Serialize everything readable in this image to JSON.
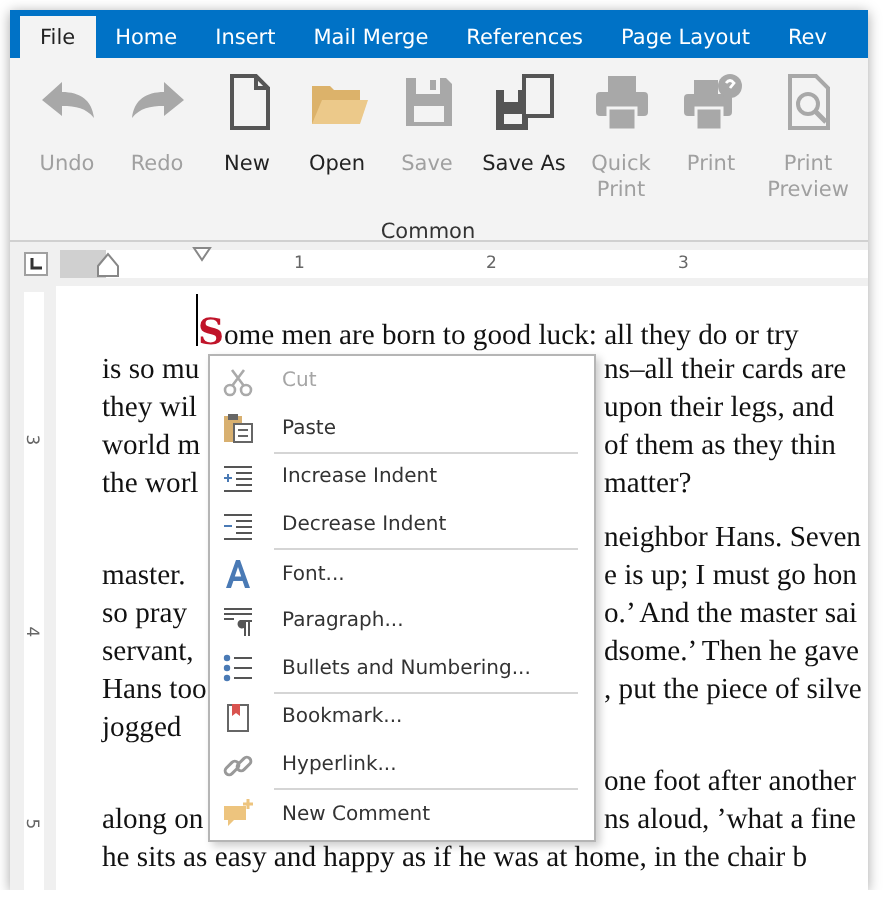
{
  "tabs": [
    {
      "label": "File",
      "selected": true
    },
    {
      "label": "Home",
      "selected": false
    },
    {
      "label": "Insert",
      "selected": false
    },
    {
      "label": "Mail Merge",
      "selected": false
    },
    {
      "label": "References",
      "selected": false
    },
    {
      "label": "Page Layout",
      "selected": false
    },
    {
      "label": "Rev",
      "selected": false
    }
  ],
  "ribbon": {
    "buttons": [
      {
        "label": "Undo",
        "disabled": true
      },
      {
        "label": "Redo",
        "disabled": true
      },
      {
        "label": "New",
        "disabled": false
      },
      {
        "label": "Open",
        "disabled": false
      },
      {
        "label": "Save",
        "disabled": true
      },
      {
        "label": "Save As",
        "disabled": false
      },
      {
        "label": "Quick Print",
        "disabled": true
      },
      {
        "label": "Print",
        "disabled": true
      },
      {
        "label": "Print Preview",
        "disabled": true
      }
    ],
    "group_label": "Common"
  },
  "ruler": {
    "numbers": [
      "1",
      "2",
      "3"
    ]
  },
  "vertical_ruler": {
    "numbers": [
      "3",
      "4",
      "5"
    ]
  },
  "document": {
    "paragraphs": [
      {
        "drop_cap": "S",
        "lines": [
          {
            "left": "ome men are born to good luck: all they do or try"
          },
          {
            "left": "is so mu",
            "right": "ns–all their cards are"
          },
          {
            "left": "they wil",
            "right": "upon their legs, and"
          },
          {
            "left": "world m",
            "right": "of them as they thin"
          },
          {
            "left": "the worl",
            "right": "matter?"
          }
        ]
      },
      {
        "lines": [
          {
            "right": "neighbor Hans. Seven"
          },
          {
            "left": "master.",
            "right": "e is up; I must go hon"
          },
          {
            "left": "so pray",
            "right": "o.’ And the master sai"
          },
          {
            "left": "servant,",
            "right": "dsome.’ Then he gave"
          },
          {
            "left": "Hans too",
            "right": ", put the piece of silve"
          },
          {
            "left": "jogged"
          }
        ]
      },
      {
        "lines": [
          {
            "right": "one foot after another"
          },
          {
            "left": "along on",
            "right": "ns aloud, ’what a fine"
          },
          {
            "left": "he sits as easy and happy as if he was at home, in the chair b"
          }
        ]
      }
    ]
  },
  "context_menu": {
    "groups": [
      [
        {
          "label": "Cut",
          "disabled": true
        },
        {
          "label": "Paste",
          "disabled": false
        }
      ],
      [
        {
          "label": "Increase Indent",
          "disabled": false
        },
        {
          "label": "Decrease Indent",
          "disabled": false
        }
      ],
      [
        {
          "label": "Font...",
          "disabled": false
        },
        {
          "label": "Paragraph...",
          "disabled": false
        },
        {
          "label": "Bullets and Numbering...",
          "disabled": false
        }
      ],
      [
        {
          "label": "Bookmark...",
          "disabled": false
        },
        {
          "label": "Hyperlink...",
          "disabled": false
        }
      ],
      [
        {
          "label": "New Comment",
          "disabled": false
        }
      ]
    ]
  }
}
